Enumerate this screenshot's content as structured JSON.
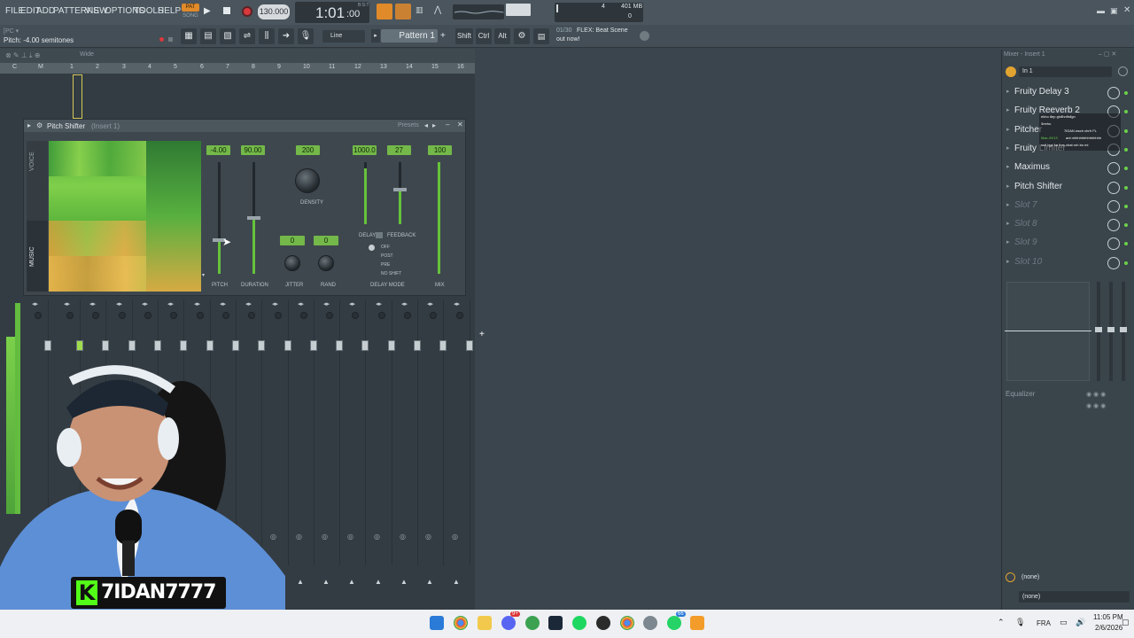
{
  "menu": [
    "FILE",
    "EDIT",
    "ADD",
    "PATTERNS",
    "VIEW",
    "OPTIONS",
    "TOOLS",
    "HELP"
  ],
  "transport": {
    "pat_label": "PAT",
    "song_label": "SONG",
    "tempo": "130.000",
    "time": "1:01",
    "time_frac": ":00",
    "time_unit": "B:S:T",
    "cpu_value": "4",
    "memory": "401 MB",
    "poly": "0"
  },
  "toolbar": {
    "pc_label": "[PC ▾",
    "hint": "Pitch: -4.00 semitones",
    "snap": "Line",
    "pattern": "Pattern 1",
    "shift": "Shift",
    "ctrl": "Ctrl",
    "alt": "Alt",
    "news_count": "01/30",
    "news_text": "FLEX: Beat Scene",
    "news_text2": "out now!"
  },
  "browser": {
    "wide": "Wide"
  },
  "ruler": [
    "C",
    "M",
    "1",
    "2",
    "3",
    "4",
    "5",
    "6",
    "7",
    "8",
    "9",
    "10",
    "11",
    "12",
    "13",
    "14",
    "15",
    "16"
  ],
  "plugin": {
    "title": "Pitch Shifter",
    "subtitle": "(Insert 1)",
    "presets": "Presets",
    "voice": "VOICE",
    "music": "MUSIC",
    "pitch_value": "-4.00",
    "duration_value": "90.00",
    "density_value": "200",
    "delay_value": "1000.0",
    "feedback_value": "27",
    "mix_value": "100",
    "jitter_value": "0",
    "rand_value": "0",
    "labels": {
      "pitch": "PITCH",
      "duration": "DURATION",
      "density": "DENSITY",
      "jitter": "JITTER",
      "rand": "RAND",
      "delay": "DELAY",
      "feedback": "FEEDBACK",
      "delay_mode": "DELAY MODE",
      "mix": "MIX"
    },
    "delay_modes": [
      "OFF",
      "POST",
      "PRE",
      "NO SHIFT"
    ],
    "pitch_level": 0.3,
    "duration_level": 0.5,
    "delay_level": 0.9,
    "feedback_level": 0.55,
    "mix_level": 1.0
  },
  "mixer_panel": {
    "title": "Mixer - Insert 1",
    "input": "In 1",
    "slots": [
      {
        "name": "Fruity Delay 3",
        "empty": false
      },
      {
        "name": "Fruity Reeverb 2",
        "empty": false
      },
      {
        "name": "Pitcher",
        "empty": false
      },
      {
        "name": "Fruity Limiter",
        "empty": false
      },
      {
        "name": "Maximus",
        "empty": false
      },
      {
        "name": "Pitch Shifter",
        "empty": false
      },
      {
        "name": "Slot 7",
        "empty": true
      },
      {
        "name": "Slot 8",
        "empty": true
      },
      {
        "name": "Slot 9",
        "empty": true
      },
      {
        "name": "Slot 10",
        "empty": true
      }
    ],
    "equalizer": "Equalizer",
    "out1": "(none)",
    "out2": "(none)"
  },
  "chat": [
    {
      "user": "",
      "text": "ekho đẹp ghđhnfhđgn"
    },
    {
      "user": "",
      "text": "3mrhu"
    },
    {
      "user": "",
      "text": "7IDAN wsch chrfr FL"
    },
    {
      "user": "Mac-XK13",
      "text": "ant nhhhhhhhhhhhhhh"
    },
    {
      "user": "",
      "text": "ssd bgs ka thrs chat roh bo mi"
    }
  ],
  "streamer": {
    "k_logo": "K",
    "name": "7IDAN7777"
  },
  "taskbar": {
    "lang": "FRA",
    "time": "11:05 PM",
    "date": "2/6/2026",
    "badge_discord": "9+",
    "badge_whatsapp": "66"
  }
}
